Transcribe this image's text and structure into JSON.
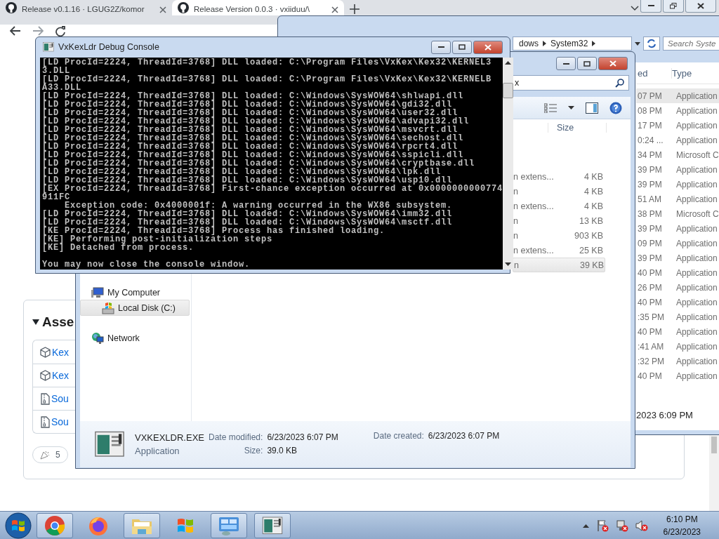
{
  "browser": {
    "tabs": [
      {
        "title": "Release v0.1.16 · LGUG2Z/komor",
        "selected": false
      },
      {
        "title": "Release Version 0.0.3 · vxiiduu/\\",
        "selected": true
      }
    ],
    "assets": {
      "heading": "Asse",
      "items": [
        {
          "kind": "package",
          "name": "Kex"
        },
        {
          "kind": "package",
          "name": "Kex"
        },
        {
          "kind": "zip",
          "name": "Sou"
        },
        {
          "kind": "zip",
          "name": "Sou"
        }
      ]
    },
    "reactions": [
      {
        "count": "5"
      }
    ]
  },
  "system32_window": {
    "breadcrumbs": [
      "dows",
      "System32"
    ],
    "search": {
      "placeholder": "Search Syste"
    },
    "columns": [
      "ed",
      "Type"
    ],
    "rows": [
      {
        "date": "07 PM",
        "type": "Application",
        "selected": true
      },
      {
        "date": "08 PM",
        "type": "Application",
        "selected": false
      },
      {
        "date": "17 PM",
        "type": "Application",
        "selected": false
      },
      {
        "date": "0:24 ...",
        "type": "Application",
        "selected": false
      },
      {
        "date": "34 PM",
        "type": "Microsoft C",
        "selected": false
      },
      {
        "date": "39 PM",
        "type": "Application",
        "selected": false
      },
      {
        "date": "39 PM",
        "type": "Application",
        "selected": false
      },
      {
        "date": "51 AM",
        "type": "Application",
        "selected": false
      },
      {
        "date": "38 PM",
        "type": "Microsoft C",
        "selected": false
      },
      {
        "date": "39 PM",
        "type": "Application",
        "selected": false
      },
      {
        "date": "09 PM",
        "type": "Application",
        "selected": false
      },
      {
        "date": "39 PM",
        "type": "Application",
        "selected": false
      },
      {
        "date": "40 PM",
        "type": "Application",
        "selected": false
      },
      {
        "date": "26 PM",
        "type": "Application",
        "selected": false
      },
      {
        "date": "40 PM",
        "type": "Application",
        "selected": false
      },
      {
        "date": ":35 PM",
        "type": "Application",
        "selected": false
      },
      {
        "date": "40 PM",
        "type": "Application",
        "selected": false
      },
      {
        "date": ":41 AM",
        "type": "Application",
        "selected": false
      },
      {
        "date": ":32 PM",
        "type": "Application",
        "selected": false
      },
      {
        "date": "40 PM",
        "type": "Application",
        "selected": false
      }
    ],
    "status": "2023 6:09 PM"
  },
  "folder_window": {
    "search": {
      "value": "x"
    },
    "columns": [
      "Size"
    ],
    "rows": [
      {
        "type": "n extens...",
        "size": "4 KB",
        "selected": false
      },
      {
        "type": "n",
        "size": "4 KB",
        "selected": false
      },
      {
        "type": "n extens...",
        "size": "4 KB",
        "selected": false
      },
      {
        "type": "n",
        "size": "13 KB",
        "selected": false
      },
      {
        "type": "n",
        "size": "903 KB",
        "selected": false
      },
      {
        "type": "n extens...",
        "size": "25 KB",
        "selected": false
      },
      {
        "type": "n",
        "size": "39 KB",
        "selected": true
      }
    ],
    "nav": [
      {
        "label": "My Computer",
        "kind": "computer",
        "selected": false,
        "children": [
          {
            "label": "Local Disk (C:)",
            "kind": "disk",
            "selected": true
          }
        ]
      },
      {
        "label": "Network",
        "kind": "network",
        "selected": false
      }
    ],
    "details": {
      "name": "VXKEXLDR.EXE",
      "type": "Application",
      "columns": [
        [
          {
            "label": "Date modified:",
            "value": "6/23/2023 6:07 PM"
          },
          {
            "label": "Size:",
            "value": "39.0 KB"
          }
        ],
        [
          {
            "label": "Date created:",
            "value": "6/23/2023 6:07 PM"
          }
        ]
      ]
    }
  },
  "console": {
    "title": "VxKexLdr Debug Console",
    "lines": [
      "[LD ProcId=2224, ThreadId=3768] DLL loaded: C:\\Program Files\\VxKex\\Kex32\\KERNEL3",
      "3.DLL",
      "[LD ProcId=2224, ThreadId=3768] DLL loaded: C:\\Program Files\\VxKex\\Kex32\\KERNELB",
      "A33.DLL",
      "[LD ProcId=2224, ThreadId=3768] DLL loaded: C:\\Windows\\SysWOW64\\shlwapi.dll",
      "[LD ProcId=2224, ThreadId=3768] DLL loaded: C:\\Windows\\SysWOW64\\gdi32.dll",
      "[LD ProcId=2224, ThreadId=3768] DLL loaded: C:\\Windows\\SysWOW64\\user32.dll",
      "[LD ProcId=2224, ThreadId=3768] DLL loaded: C:\\Windows\\SysWOW64\\advapi32.dll",
      "[LD ProcId=2224, ThreadId=3768] DLL loaded: C:\\Windows\\SysWOW64\\msvcrt.dll",
      "[LD ProcId=2224, ThreadId=3768] DLL loaded: C:\\Windows\\SysWOW64\\sechost.dll",
      "[LD ProcId=2224, ThreadId=3768] DLL loaded: C:\\Windows\\SysWOW64\\rpcrt4.dll",
      "[LD ProcId=2224, ThreadId=3768] DLL loaded: C:\\Windows\\SysWOW64\\sspicli.dll",
      "[LD ProcId=2224, ThreadId=3768] DLL loaded: C:\\Windows\\SysWOW64\\cryptbase.dll",
      "[LD ProcId=2224, ThreadId=3768] DLL loaded: C:\\Windows\\SysWOW64\\lpk.dll",
      "[LD ProcId=2224, ThreadId=3768] DLL loaded: C:\\Windows\\SysWOW64\\usp10.dll",
      "[EX ProcId=2224, ThreadId=3768] First-chance exception occurred at 0x0000000000774",
      "911FC",
      "    Exception code: 0x4000001f: A warning occurred in the WX86 subsystem.",
      "[LD ProcId=2224, ThreadId=3768] DLL loaded: C:\\Windows\\SysWOW64\\imm32.dll",
      "[LD ProcId=2224, ThreadId=3768] DLL loaded: C:\\Windows\\SysWOW64\\msctf.dll",
      "[KE ProcId=2224, ThreadId=3768] Process has finished loading.",
      "[KE] Performing post-initialization steps",
      "[KE] Detached from process."
    ],
    "final_message": "You may now close the console window."
  },
  "taskbar": {
    "apps": [
      {
        "kind": "chrome",
        "running": true
      },
      {
        "kind": "firefox",
        "running": false
      },
      {
        "kind": "folder",
        "running": true
      },
      {
        "kind": "flag",
        "running": false
      },
      {
        "kind": "panel",
        "running": true
      },
      {
        "kind": "console",
        "running": true
      }
    ],
    "clock": {
      "time": "6:10 PM",
      "date": "6/23/2023"
    }
  }
}
